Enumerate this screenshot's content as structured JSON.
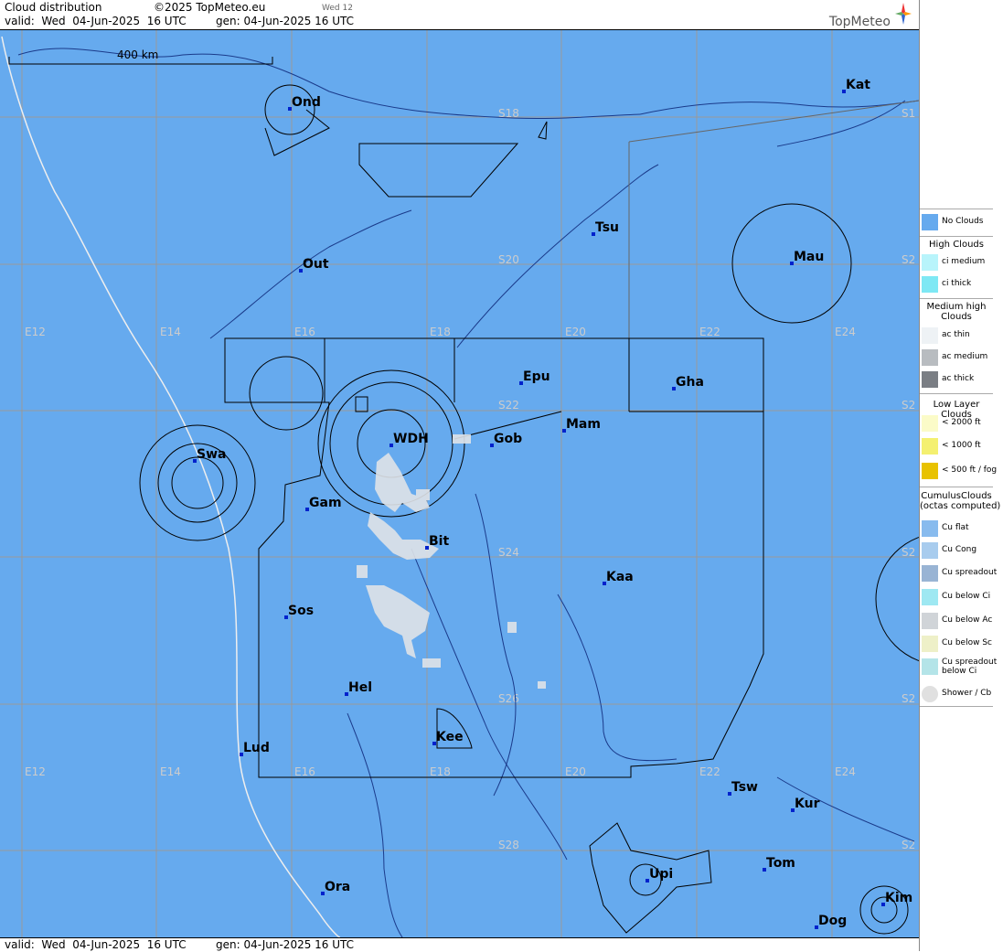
{
  "header": {
    "title": "Cloud distribution",
    "copyright": "©2025 TopMeteo.eu",
    "tab_label": "Wed 12",
    "valid": "valid:  Wed  04-Jun-2025  16 UTC",
    "gen": "gen: 04-Jun-2025 16 UTC",
    "logo_text": "TopMeteo"
  },
  "footer": {
    "valid": "valid:  Wed  04-Jun-2025  16 UTC",
    "gen": "gen: 04-Jun-2025 16 UTC"
  },
  "map": {
    "scale_label": "400 km",
    "background_color": "#66aaee",
    "lon_labels": [
      "E12",
      "E14",
      "E16",
      "E18",
      "E20",
      "E22",
      "E24"
    ],
    "lat_labels": [
      "S18",
      "S20",
      "S22",
      "S24",
      "S26",
      "S28"
    ],
    "places": [
      "Ond",
      "Kat",
      "Tsu",
      "Out",
      "Mau",
      "Epu",
      "Gha",
      "Mam",
      "WDH",
      "Gob",
      "Swa",
      "Gam",
      "Bit",
      "Kaa",
      "Sos",
      "Hel",
      "Kee",
      "Lud",
      "Tsw",
      "Kur",
      "Tom",
      "Upi",
      "Ora",
      "Kim",
      "Dog"
    ]
  },
  "legend": {
    "no_clouds": "No Clouds",
    "high_title": "High Clouds",
    "ci_medium": "ci medium",
    "ci_thick": "ci thick",
    "medium_title": "Medium high\nClouds",
    "ac_thin": "ac thin",
    "ac_medium": "ac medium",
    "ac_thick": "ac thick",
    "low_title": "Low Layer Clouds",
    "low_2000": "< 2000 ft",
    "low_1000": "< 1000 ft",
    "low_500": "< 500 ft / fog",
    "cu_title": "CumulusClouds\n(octas computed)",
    "cu_flat": "Cu flat",
    "cu_cong": "Cu Cong",
    "cu_spreadout": "Cu spreadout",
    "cu_below_ci": "Cu below Ci",
    "cu_below_ac": "Cu below Ac",
    "cu_below_sc": "Cu below Sc",
    "cu_spreadout_below_ci": "Cu spreadout\nbelow Ci",
    "shower": "Shower / Cb"
  }
}
